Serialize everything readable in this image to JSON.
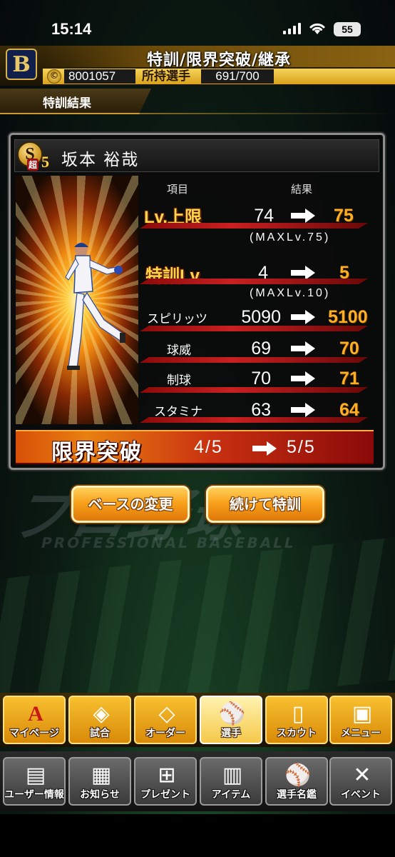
{
  "status_bar": {
    "time": "15:14",
    "battery": "55"
  },
  "header": {
    "title": "特訓/限界突破/継承",
    "team_logo": "B",
    "coin_symbol": "©",
    "coins": "8001057",
    "owned_label": "所持選手",
    "owned_value": "691/700"
  },
  "section": {
    "label": "特訓結果"
  },
  "player": {
    "rank_letter": "S",
    "rank_sub": "超",
    "rank_num": "5",
    "name": "坂本 裕哉"
  },
  "stats": {
    "col_item": "項目",
    "col_result": "結果",
    "level": {
      "label": "Lv.上限",
      "before": "74",
      "after": "75",
      "max": "(MAXLv.75)"
    },
    "training": {
      "label": "特訓Lv.",
      "before": "4",
      "after": "5",
      "max": "(MAXLv.10)"
    },
    "rows": [
      {
        "label": "スピリッツ",
        "before": "5090",
        "after": "5100"
      },
      {
        "label": "球威",
        "before": "69",
        "after": "70"
      },
      {
        "label": "制球",
        "before": "70",
        "after": "71"
      },
      {
        "label": "スタミナ",
        "before": "63",
        "after": "64"
      }
    ]
  },
  "limit_break": {
    "label": "限界突破",
    "before": "4/5",
    "after": "5/5"
  },
  "buttons": {
    "change_base": "ベースの変更",
    "continue_training": "続けて特訓"
  },
  "nav_primary": [
    {
      "label": "マイページ",
      "icon": "a-logo-icon"
    },
    {
      "label": "試合",
      "icon": "stadium-icon"
    },
    {
      "label": "オーダー",
      "icon": "field-order-icon"
    },
    {
      "label": "選手",
      "icon": "player-icon"
    },
    {
      "label": "スカウト",
      "icon": "scout-card-icon"
    },
    {
      "label": "メニュー",
      "icon": "menu-character-icon"
    }
  ],
  "nav_secondary": [
    {
      "label": "ユーザー情報",
      "icon": "user-info-icon"
    },
    {
      "label": "お知らせ",
      "icon": "notice-icon"
    },
    {
      "label": "プレゼント",
      "icon": "gift-icon"
    },
    {
      "label": "アイテム",
      "icon": "item-book-icon"
    },
    {
      "label": "選手名鑑",
      "icon": "player-directory-icon"
    },
    {
      "label": "イベント",
      "icon": "event-bat-ball-icon"
    }
  ],
  "colors": {
    "accent": "#f9a21c",
    "result": "#ffb020",
    "limit_bar": "#c83010"
  }
}
